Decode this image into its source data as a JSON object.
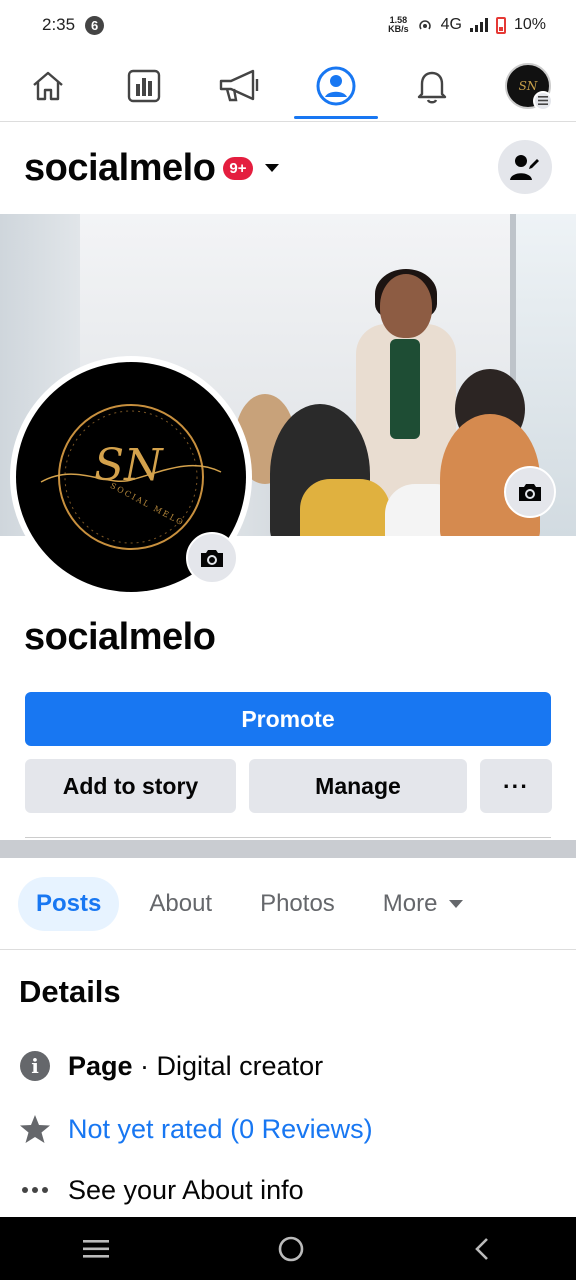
{
  "status_bar": {
    "time": "2:35",
    "notification_count": "6",
    "net_speed_value": "1.58",
    "net_speed_unit": "KB/s",
    "network": "4G",
    "battery": "10%"
  },
  "top_nav": {
    "tabs": [
      "home",
      "insights",
      "ads",
      "profile",
      "notifications",
      "menu"
    ],
    "active": "profile"
  },
  "header": {
    "page_name": "socialmelo",
    "badge": "9+"
  },
  "profile": {
    "name": "socialmelo",
    "logo_text": "SN",
    "logo_subtext": "SOCIAL MELO"
  },
  "actions": {
    "promote": "Promote",
    "add_to_story": "Add to story",
    "manage": "Manage",
    "more": "···"
  },
  "tabs": [
    {
      "label": "Posts",
      "active": true
    },
    {
      "label": "About",
      "active": false
    },
    {
      "label": "Photos",
      "active": false
    },
    {
      "label": "More",
      "active": false
    }
  ],
  "details": {
    "title": "Details",
    "page_label": "Page",
    "page_category": " · Digital creator",
    "rating": "Not yet rated (0 Reviews)",
    "about": "See your About info"
  },
  "colors": {
    "accent": "#1877f2",
    "badge": "#e41e3f",
    "button_gray": "#e4e6eb"
  }
}
